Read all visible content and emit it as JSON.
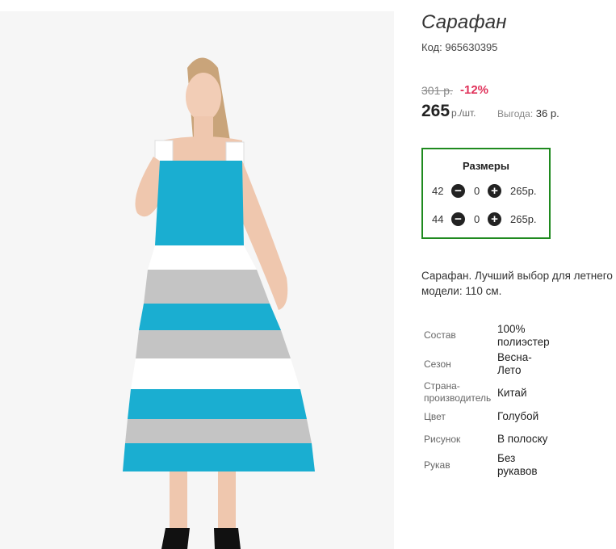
{
  "product": {
    "title": "Сарафан",
    "code_label": "Код:",
    "code_value": "965630395",
    "old_price": "301 р.",
    "discount": "-12%",
    "price": "265",
    "price_unit": "р./шт.",
    "savings_label": "Выгода:",
    "savings_value": "36 р."
  },
  "sizes": {
    "header": "Размеры",
    "rows": [
      {
        "size": "42",
        "qty": "0",
        "price": "265р."
      },
      {
        "size": "44",
        "qty": "0",
        "price": "265р."
      }
    ]
  },
  "description": {
    "line1": "Сарафан. Лучший выбор для летнего",
    "line2": "модели: 110 см."
  },
  "specs": [
    {
      "key": "Состав",
      "value": "100% полиэстер"
    },
    {
      "key": "Сезон",
      "value": "Весна-Лето"
    },
    {
      "key": "Страна-производитель",
      "value": "Китай"
    },
    {
      "key": "Цвет",
      "value": "Голубой"
    },
    {
      "key": "Рисунок",
      "value": "В полоску"
    },
    {
      "key": "Рукав",
      "value": "Без рукавов"
    }
  ],
  "colors": {
    "accent_frame": "#1f8a1f",
    "discount": "#e0325a",
    "dress_blue": "#1aaed1",
    "dress_gray": "#c4c4c4"
  }
}
